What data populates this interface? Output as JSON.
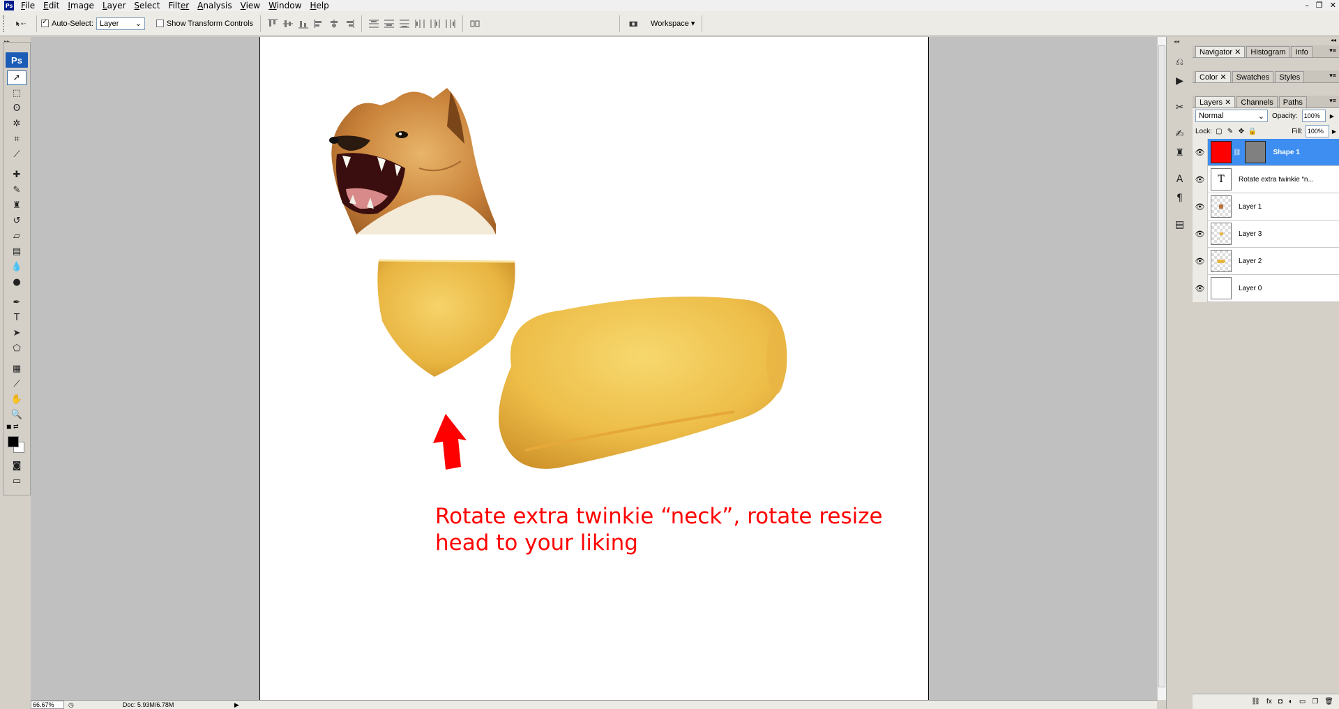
{
  "app": {
    "icon_label": "Ps",
    "logo_label": "Ps"
  },
  "menu": [
    {
      "label": "File",
      "mnemonic": "F",
      "rest": "ile"
    },
    {
      "label": "Edit",
      "mnemonic": "E",
      "rest": "dit"
    },
    {
      "label": "Image",
      "mnemonic": "I",
      "rest": "mage"
    },
    {
      "label": "Layer",
      "mnemonic": "L",
      "rest": "ayer"
    },
    {
      "label": "Select",
      "mnemonic": "S",
      "rest": "elect"
    },
    {
      "label": "Filter",
      "mnemonic": "Filt",
      "rest": "er"
    },
    {
      "label": "Analysis",
      "mnemonic": "A",
      "rest": "nalysis"
    },
    {
      "label": "View",
      "mnemonic": "V",
      "rest": "iew"
    },
    {
      "label": "Window",
      "mnemonic": "W",
      "rest": "indow"
    },
    {
      "label": "Help",
      "mnemonic": "H",
      "rest": "elp"
    }
  ],
  "window_controls": {
    "minimize": "–",
    "restore": "❐",
    "close": "✕"
  },
  "options": {
    "auto_select_label": "Auto-Select:",
    "auto_select_checked": true,
    "auto_select_value": "Layer",
    "show_transform_label": "Show Transform Controls",
    "show_transform_checked": false,
    "workspace_label": "Workspace ▾"
  },
  "status": {
    "zoom": "66.67%",
    "doc_size": "Doc: 5.93M/6.78M"
  },
  "panels": {
    "group1_tabs": [
      "Navigator",
      "Histogram",
      "Info"
    ],
    "group2_tabs": [
      "Color",
      "Swatches",
      "Styles"
    ],
    "group3_tabs": [
      "Layers",
      "Channels",
      "Paths"
    ]
  },
  "layers_panel": {
    "blend_mode": "Normal",
    "opacity_label": "Opacity:",
    "opacity_value": "100%",
    "lock_label": "Lock:",
    "fill_label": "Fill:",
    "fill_value": "100%",
    "layers": [
      {
        "name": "Shape 1",
        "selected": true
      },
      {
        "name": "Rotate extra twinkie “n...",
        "selected": false
      },
      {
        "name": "Layer 1",
        "selected": false
      },
      {
        "name": "Layer 3",
        "selected": false
      },
      {
        "name": "Layer 2",
        "selected": false
      },
      {
        "name": "Layer 0",
        "selected": false
      }
    ]
  },
  "canvas": {
    "annotation_line1": "Rotate extra twinkie “neck”, rotate resize",
    "annotation_line2": "head to your liking"
  },
  "colors": {
    "annotation_red": "#ff0000",
    "foreground": "#000000",
    "background": "#ffffff",
    "selection_blue": "#3d8ef0",
    "shape_fill": "#ff0000"
  },
  "icons": {
    "move_tool": "move-icon",
    "eye": "eye-icon"
  }
}
